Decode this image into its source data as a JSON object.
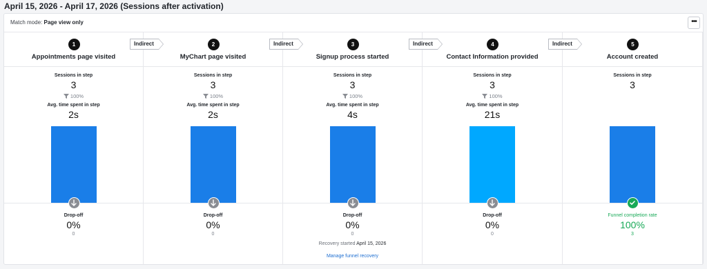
{
  "date_range": "April 15, 2026 - April 17, 2026 (Sessions after activation)",
  "match_mode": {
    "label": "Match mode:",
    "value": "Page view only"
  },
  "more_button": "•••",
  "connector_label": "Indirect",
  "labels": {
    "sessions_in_step": "Sessions in step",
    "avg_time": "Avg. time spent in step",
    "drop_off": "Drop-off",
    "completion_rate": "Funnel completion rate"
  },
  "colors": {
    "bar_default": "#1a7ee8",
    "bar_highlight": "#00a8ff",
    "success": "#18a957",
    "link": "#1f6fd1"
  },
  "steps": [
    {
      "num": "1",
      "name": "Appointments page visited",
      "sessions": "3",
      "pct": "100%",
      "avg_time": "2s",
      "drop_pct": "0%",
      "drop_count": "0"
    },
    {
      "num": "2",
      "name": "MyChart page visited",
      "sessions": "3",
      "pct": "100%",
      "avg_time": "2s",
      "drop_pct": "0%",
      "drop_count": "0"
    },
    {
      "num": "3",
      "name": "Signup process started",
      "sessions": "3",
      "pct": "100%",
      "avg_time": "4s",
      "drop_pct": "0%",
      "drop_count": "0"
    },
    {
      "num": "4",
      "name": "Contact Information provided",
      "sessions": "3",
      "pct": "100%",
      "avg_time": "21s",
      "drop_pct": "0%",
      "drop_count": "0"
    },
    {
      "num": "5",
      "name": "Account created",
      "sessions": "3",
      "completion_pct": "100%",
      "completion_count": "3"
    }
  ],
  "recovery": {
    "text": "Recovery started",
    "date": "April 15, 2026",
    "link": "Manage funnel recovery"
  },
  "chart_data": {
    "type": "bar",
    "categories": [
      "Appointments page visited",
      "MyChart page visited",
      "Signup process started",
      "Contact Information provided",
      "Account created"
    ],
    "values": [
      3,
      3,
      3,
      3,
      3
    ],
    "title": "",
    "xlabel": "",
    "ylabel": "Sessions in step"
  }
}
